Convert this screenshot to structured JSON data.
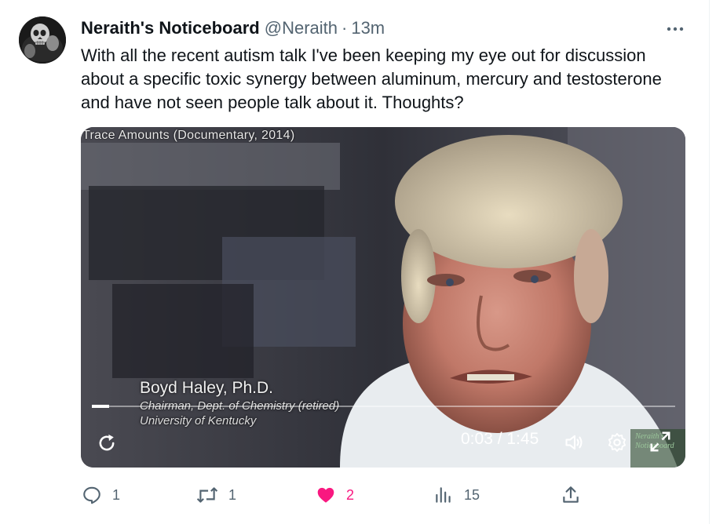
{
  "tweet": {
    "display_name": "Neraith's Noticeboard",
    "handle": "@Neraith",
    "separator": "·",
    "time": "13m",
    "text": "With all the recent autism talk I've been keeping my eye out for discussion about a specific toxic synergy between aluminum, mercury and testosterone and have not seen people talk about it. Thoughts?",
    "more_icon": "more-horizontal-icon"
  },
  "video": {
    "overlay_title": "Trace Amounts (Documentary, 2014)",
    "lower_third": {
      "name": "Boyd Haley, Ph.D.",
      "role": "Chairman, Dept. of Chemistry (retired)",
      "org": "University of Kentucky"
    },
    "watermark": "Neraith's Noticeboard",
    "time_readout": "0:03 / 1:45",
    "progress": 0.029,
    "controls": {
      "replay_icon": "replay-icon",
      "volume_icon": "volume-icon",
      "settings_icon": "settings-gear-icon",
      "fullscreen_icon": "fullscreen-icon"
    }
  },
  "actions": {
    "reply": {
      "icon": "reply-icon",
      "count": "1"
    },
    "repost": {
      "icon": "repost-icon",
      "count": "1"
    },
    "like": {
      "icon": "heart-icon",
      "count": "2",
      "liked": true
    },
    "views": {
      "icon": "views-icon",
      "count": "15"
    },
    "share": {
      "icon": "share-icon"
    }
  },
  "colors": {
    "text_primary": "#0f1419",
    "text_secondary": "#536471",
    "like_pink": "#f91880"
  }
}
